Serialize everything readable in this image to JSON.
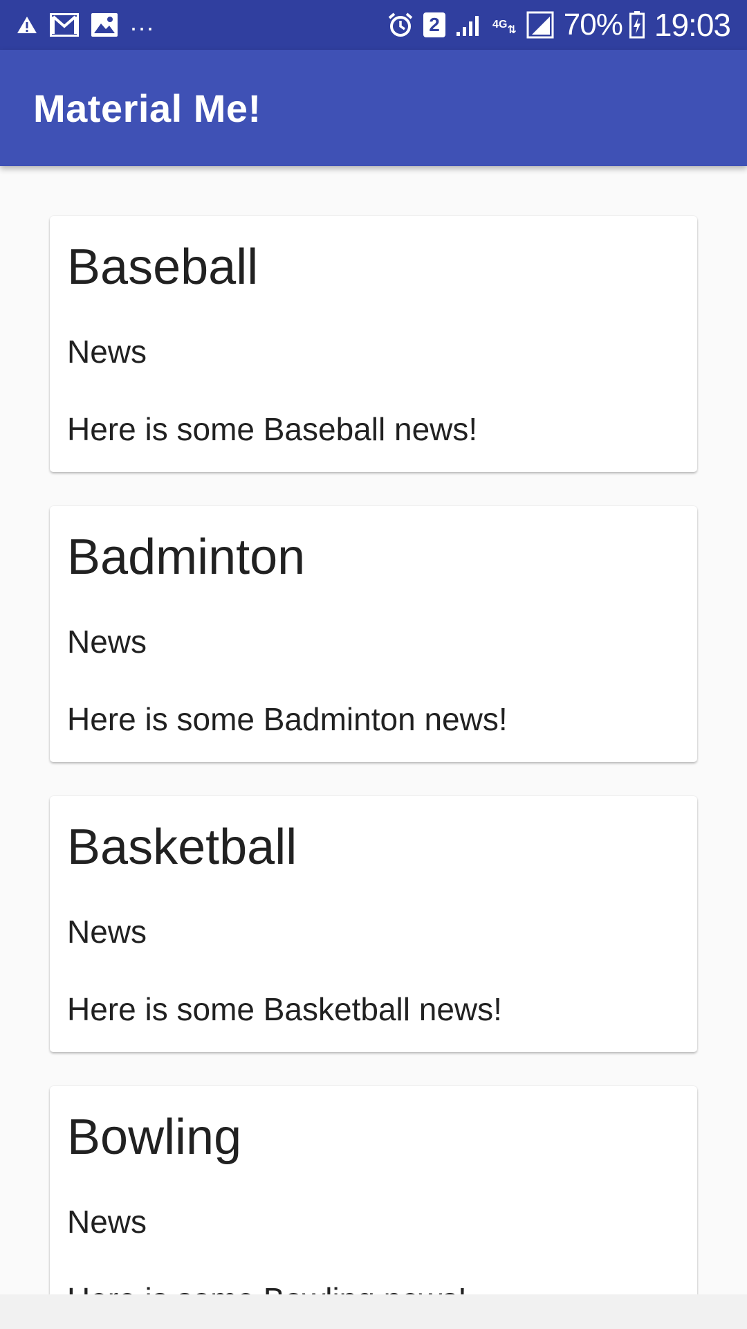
{
  "status_bar": {
    "left_icons": [
      "warning-icon",
      "gmail-icon",
      "gallery-icon"
    ],
    "overflow_indicator": "...",
    "sim_badge": "2",
    "network_type": "4G",
    "battery_percent": "70%",
    "time": "19:03",
    "colors": {
      "background": "#303f9f"
    }
  },
  "app_bar": {
    "title": "Material Me!",
    "colors": {
      "background": "#3f51b5"
    }
  },
  "cards": [
    {
      "title": "Baseball",
      "subtitle": "News",
      "info": "Here is some Baseball news!"
    },
    {
      "title": "Badminton",
      "subtitle": "News",
      "info": "Here is some Badminton news!"
    },
    {
      "title": "Basketball",
      "subtitle": "News",
      "info": "Here is some Basketball news!"
    },
    {
      "title": "Bowling",
      "subtitle": "News",
      "info": "Here is some Bowling news!"
    }
  ]
}
